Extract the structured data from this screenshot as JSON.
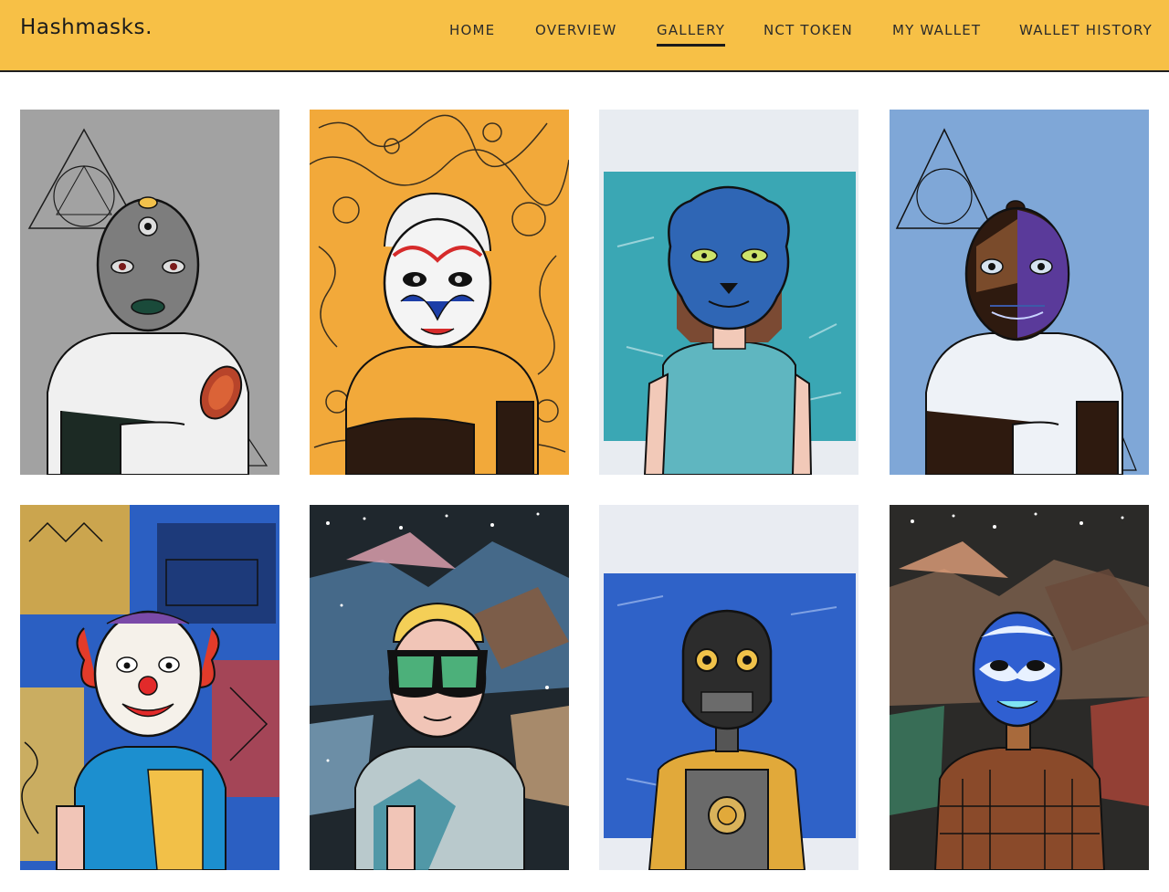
{
  "header": {
    "brand": "Hashmasks.",
    "nav": {
      "home": "HOME",
      "overview": "OVERVIEW",
      "gallery": "GALLERY",
      "nct_token": "NCT TOKEN",
      "my_wallet": "MY WALLET",
      "wallet_history": "WALLET HISTORY"
    },
    "active_nav": "GALLERY"
  },
  "gallery": {
    "items": [
      {
        "background": "#9a9a9a",
        "mask": "grey-patterned-mask",
        "skin": "#1e2a22"
      },
      {
        "background": "#f2a93a",
        "mask": "opera-mask",
        "skin": "#2b1a10"
      },
      {
        "background": "#3aa7b4",
        "mask": "blue-lion-mask",
        "skin": "#f2c9b8"
      },
      {
        "background": "#6f9bd1",
        "mask": "purple-patch-mask",
        "skin": "#2e1a0f"
      },
      {
        "background": "#1f4fa8",
        "mask": "clown-mask",
        "skin": "#f1c5b7"
      },
      {
        "background": "#27323a",
        "mask": "diving-goggles",
        "skin": "#f1c5b7"
      },
      {
        "background": "#2f62c8",
        "mask": "robot-head",
        "skin": "#e1a93a"
      },
      {
        "background": "#2b2a28",
        "mask": "blue-opera-mask",
        "skin": "#a86a3c"
      }
    ]
  }
}
